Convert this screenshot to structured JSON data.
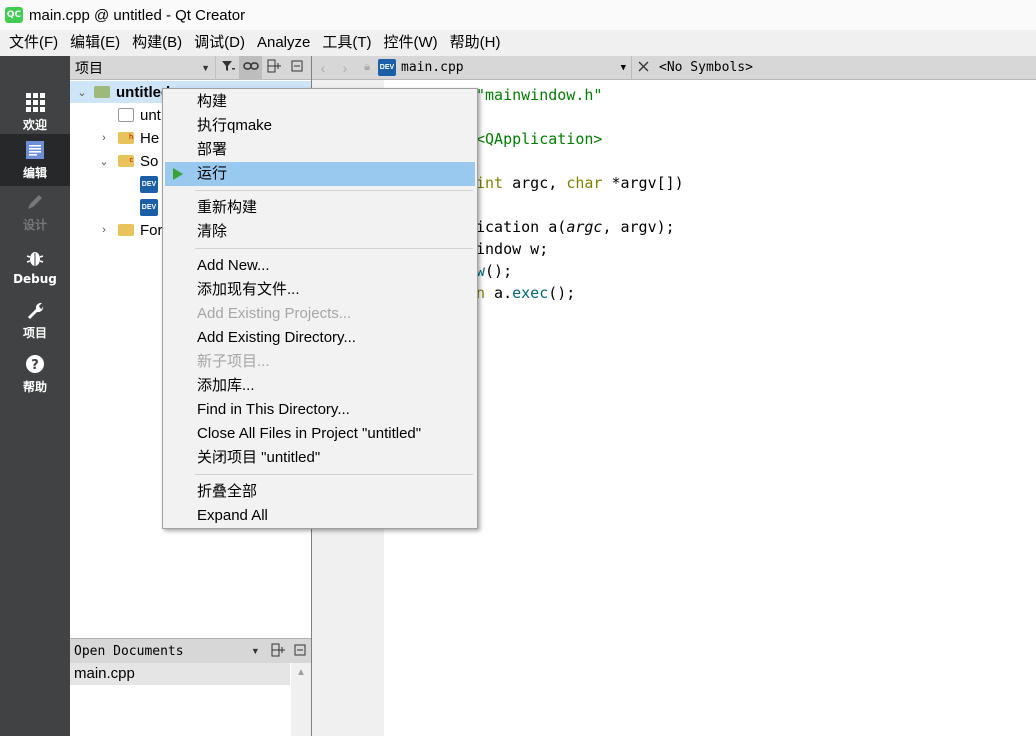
{
  "window": {
    "title": "main.cpp @ untitled - Qt Creator",
    "logo": "QC"
  },
  "menubar": [
    "文件(F)",
    "编辑(E)",
    "构建(B)",
    "调试(D)",
    "Analyze",
    "工具(T)",
    "控件(W)",
    "帮助(H)"
  ],
  "modes": [
    {
      "label": "欢迎",
      "icon": "grid-icon",
      "state": "normal"
    },
    {
      "label": "编辑",
      "icon": "document-icon",
      "state": "active"
    },
    {
      "label": "设计",
      "icon": "pencil-icon",
      "state": "disabled"
    },
    {
      "label": "Debug",
      "icon": "bug-icon",
      "state": "normal"
    },
    {
      "label": "项目",
      "icon": "wrench-icon",
      "state": "normal"
    },
    {
      "label": "帮助",
      "icon": "question-icon",
      "state": "normal"
    }
  ],
  "project_panel": {
    "combo_label": "项目",
    "tree": [
      {
        "label": "untitled",
        "arrow": "expanded"
      },
      {
        "label": "unt",
        "arrow": "none"
      },
      {
        "label": "He",
        "arrow": "collapsed"
      },
      {
        "label": "So",
        "arrow": "expanded"
      },
      {
        "label": "",
        "arrow": "none"
      },
      {
        "label": "",
        "arrow": "none"
      },
      {
        "label": "For",
        "arrow": "collapsed"
      }
    ]
  },
  "open_documents": {
    "label": "Open Documents",
    "items": [
      "main.cpp"
    ]
  },
  "editor": {
    "file_combo": "main.cpp",
    "symbols_combo": "<No Symbols>",
    "lines": [
      {
        "parts": [
          {
            "t": "\"mainwindow.h\"",
            "c": "str"
          }
        ]
      },
      {
        "parts": [
          {
            "t": "",
            "c": ""
          }
        ]
      },
      {
        "parts": [
          {
            "t": "<QApplication>",
            "c": "str"
          }
        ]
      },
      {
        "parts": [
          {
            "t": "",
            "c": ""
          }
        ]
      },
      {
        "parts": [
          {
            "t": "int",
            "c": "kw"
          },
          {
            "t": " argc, ",
            "c": ""
          },
          {
            "t": "char",
            "c": "kw"
          },
          {
            "t": " *argv[])",
            "c": ""
          }
        ]
      },
      {
        "parts": [
          {
            "t": "",
            "c": ""
          }
        ]
      },
      {
        "parts": [
          {
            "t": "ication a(",
            "c": ""
          },
          {
            "t": "argc",
            "c": "it"
          },
          {
            "t": ", argv);",
            "c": ""
          }
        ]
      },
      {
        "parts": [
          {
            "t": "indow w;",
            "c": ""
          }
        ]
      },
      {
        "parts": [
          {
            "t": "w",
            "c": "fn"
          },
          {
            "t": "();",
            "c": ""
          }
        ]
      },
      {
        "parts": [
          {
            "t": "n",
            "c": "kw"
          },
          {
            "t": " a.",
            "c": ""
          },
          {
            "t": "exec",
            "c": "fn"
          },
          {
            "t": "();",
            "c": ""
          }
        ]
      }
    ]
  },
  "context_menu": {
    "groups": [
      [
        {
          "label": "构建",
          "enabled": true
        },
        {
          "label": "执行qmake",
          "enabled": true
        },
        {
          "label": "部署",
          "enabled": true
        },
        {
          "label": "运行",
          "enabled": true,
          "highlighted": true,
          "icon": "run-icon"
        }
      ],
      [
        {
          "label": "重新构建",
          "enabled": true
        },
        {
          "label": "清除",
          "enabled": true
        }
      ],
      [
        {
          "label": "Add New...",
          "enabled": true
        },
        {
          "label": "添加现有文件...",
          "enabled": true
        },
        {
          "label": "Add Existing Projects...",
          "enabled": false
        },
        {
          "label": "Add Existing Directory...",
          "enabled": true
        },
        {
          "label": "新子项目...",
          "enabled": false
        },
        {
          "label": "添加库...",
          "enabled": true
        },
        {
          "label": "Find in This Directory...",
          "enabled": true
        },
        {
          "label": "Close All Files in Project \"untitled\"",
          "enabled": true
        },
        {
          "label": "关闭项目 \"untitled\"",
          "enabled": true
        }
      ],
      [
        {
          "label": "折叠全部",
          "enabled": true
        },
        {
          "label": "Expand All",
          "enabled": true
        }
      ]
    ]
  },
  "colors": {
    "sidebar": "#404244",
    "sidebar_active": "#262829",
    "highlight": "#99c9ef",
    "run_green": "#3aa335"
  }
}
